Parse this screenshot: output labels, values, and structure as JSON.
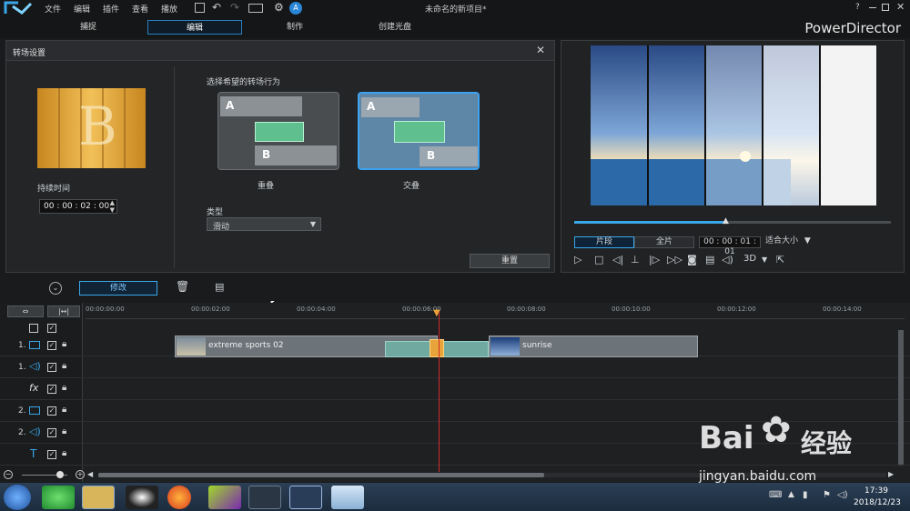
{
  "menu": {
    "file": "文件",
    "edit": "编辑",
    "plugins": "插件",
    "view": "查看",
    "play": "播放",
    "badge": "A",
    "title": "未命名的新项目*",
    "help": "?"
  },
  "tabs": {
    "capture": "捕捉",
    "edit": "编辑",
    "produce": "制作",
    "disc": "创建光盘"
  },
  "brand": "PowerDirector",
  "transition": {
    "title": "转场设置",
    "thumb_letter": "B",
    "duration_label": "持续时间",
    "duration_value": "00 : 00 : 02 : 00",
    "behavior_label": "选择希望的转场行为",
    "overlap_label": "重叠",
    "cross_label": "交叠",
    "type_label": "类型",
    "type_value": "滑动",
    "reset": "重置",
    "letter_a": "A",
    "letter_b": "B"
  },
  "preview": {
    "progress": 0.48,
    "mode_clip": "片段",
    "mode_movie": "全片",
    "timecode": "00 : 00 : 01 : 01",
    "fit": "适合大小",
    "threed": "3D"
  },
  "timeline": {
    "modify": "修改",
    "ruler": [
      "00:00:00:00",
      "00:00:02:00",
      "00:00:04:00",
      "00:00:06:00",
      "00:00:08:00",
      "00:00:10:00",
      "00:00:12:00",
      "00:00:14:00"
    ],
    "tracks": [
      {
        "num": "1.",
        "type": "video"
      },
      {
        "num": "1.",
        "type": "audio"
      },
      {
        "num": "",
        "type": "fx",
        "symbol": "fx"
      },
      {
        "num": "2.",
        "type": "video"
      },
      {
        "num": "2.",
        "type": "audio"
      },
      {
        "num": "",
        "type": "title",
        "symbol": "T"
      }
    ],
    "clip_a": "extreme sports 02",
    "clip_b": "sunrise"
  },
  "taskbar": {
    "time": "17:39",
    "date": "2018/12/23"
  },
  "watermark": {
    "logo_left": "Bai",
    "logo_right": "经验",
    "url": "jingyan.baidu.com"
  }
}
